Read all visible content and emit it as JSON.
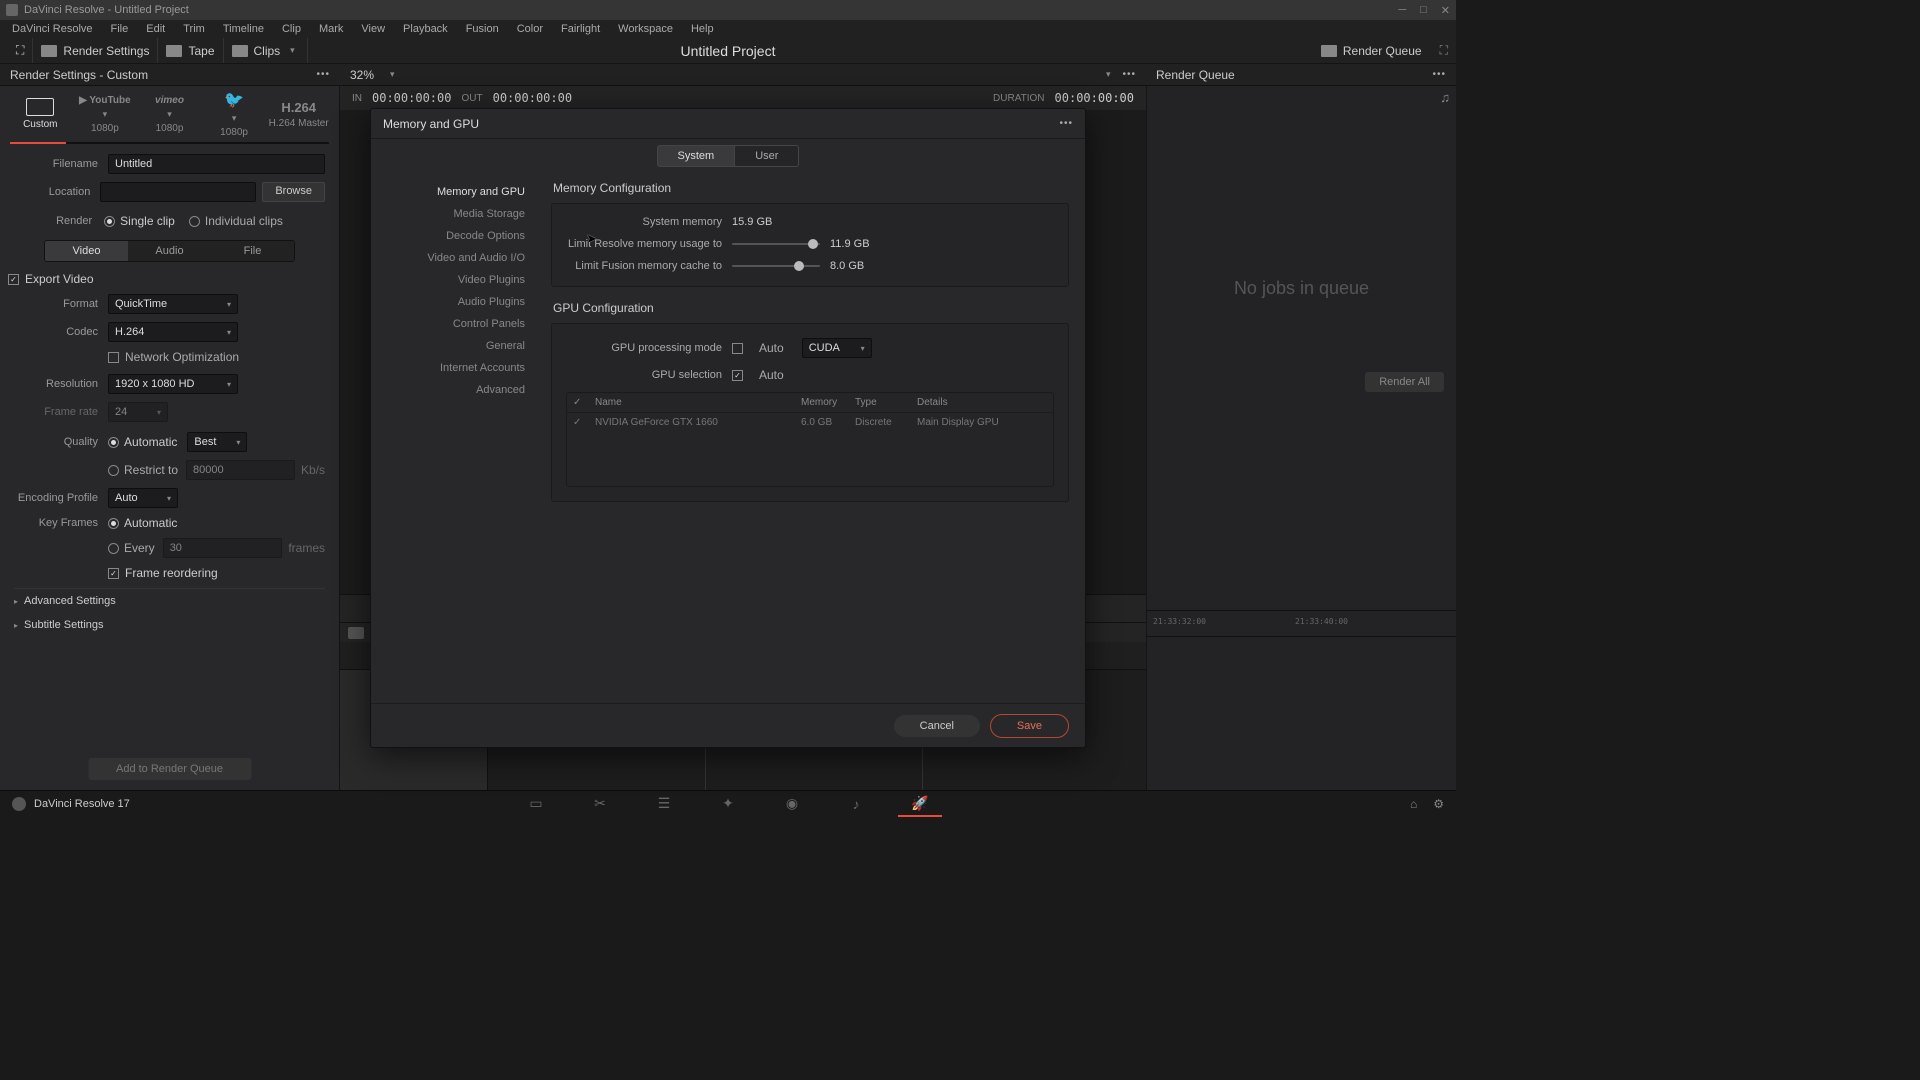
{
  "window": {
    "title": "DaVinci Resolve - Untitled Project"
  },
  "menu": [
    "DaVinci Resolve",
    "File",
    "Edit",
    "Trim",
    "Timeline",
    "Clip",
    "Mark",
    "View",
    "Playback",
    "Fusion",
    "Color",
    "Fairlight",
    "Workspace",
    "Help"
  ],
  "toolbar": {
    "render_settings": "Render Settings",
    "tape": "Tape",
    "clips": "Clips",
    "project_title": "Untitled Project",
    "render_queue": "Render Queue"
  },
  "panel_header": {
    "left": "Render Settings - Custom",
    "zoom": "32%",
    "right": "Render Queue"
  },
  "tc": {
    "in_label": "IN",
    "in": "00:00:00:00",
    "out_label": "OUT",
    "out": "00:00:00:00",
    "dur_label": "DURATION",
    "dur": "00:00:00:00"
  },
  "presets": [
    {
      "label": "Custom",
      "active": true
    },
    {
      "label": "1080p",
      "brand": "▶ YouTube"
    },
    {
      "label": "1080p",
      "brand": "vimeo"
    },
    {
      "label": "1080p",
      "brand": "🐦"
    },
    {
      "label": "H.264 Master",
      "brand": "H.264"
    }
  ],
  "render_form": {
    "filename_label": "Filename",
    "filename": "Untitled",
    "location_label": "Location",
    "location": "",
    "browse": "Browse",
    "render_label": "Render",
    "single": "Single clip",
    "individual": "Individual clips",
    "tabs": [
      "Video",
      "Audio",
      "File"
    ],
    "export_video": "Export Video",
    "format_label": "Format",
    "format": "QuickTime",
    "codec_label": "Codec",
    "codec": "H.264",
    "netopt": "Network Optimization",
    "res_label": "Resolution",
    "res": "1920 x 1080 HD",
    "fps_label": "Frame rate",
    "fps": "24",
    "quality_label": "Quality",
    "q_auto": "Automatic",
    "q_best": "Best",
    "restrict": "Restrict to",
    "restrict_val": "80000",
    "kbs": "Kb/s",
    "enc_label": "Encoding Profile",
    "enc": "Auto",
    "kf_label": "Key Frames",
    "kf_auto": "Automatic",
    "kf_every": "Every",
    "kf_n": "30",
    "kf_frames": "frames",
    "reorder": "Frame reordering",
    "adv": "Advanced Settings",
    "sub": "Subtitle Settings",
    "add": "Add to Render Queue"
  },
  "queue": {
    "empty": "No jobs in queue",
    "render_all": "Render All"
  },
  "timeline_ticks": [
    "21:33:32:00",
    "21:33:40:00"
  ],
  "prefs": {
    "title": "Memory and GPU",
    "sysuser": [
      "System",
      "User"
    ],
    "side": [
      "Memory and GPU",
      "Media Storage",
      "Decode Options",
      "Video and Audio I/O",
      "Video Plugins",
      "Audio Plugins",
      "Control Panels",
      "General",
      "Internet Accounts",
      "Advanced"
    ],
    "mem_header": "Memory Configuration",
    "sys_mem_label": "System memory",
    "sys_mem": "15.9 GB",
    "resolve_label": "Limit Resolve memory usage to",
    "resolve_val": "11.9 GB",
    "fusion_label": "Limit Fusion memory cache to",
    "fusion_val": "8.0 GB",
    "gpu_header": "GPU Configuration",
    "gpu_mode_label": "GPU processing mode",
    "auto": "Auto",
    "gpu_mode": "CUDA",
    "gpu_sel_label": "GPU selection",
    "table": {
      "h_chk": "✓",
      "h_name": "Name",
      "h_mem": "Memory",
      "h_type": "Type",
      "h_det": "Details",
      "r_name": "NVIDIA GeForce GTX 1660",
      "r_mem": "6.0 GB",
      "r_type": "Discrete",
      "r_det": "Main Display GPU"
    },
    "cancel": "Cancel",
    "save": "Save"
  },
  "footer": {
    "app": "DaVinci Resolve 17"
  }
}
